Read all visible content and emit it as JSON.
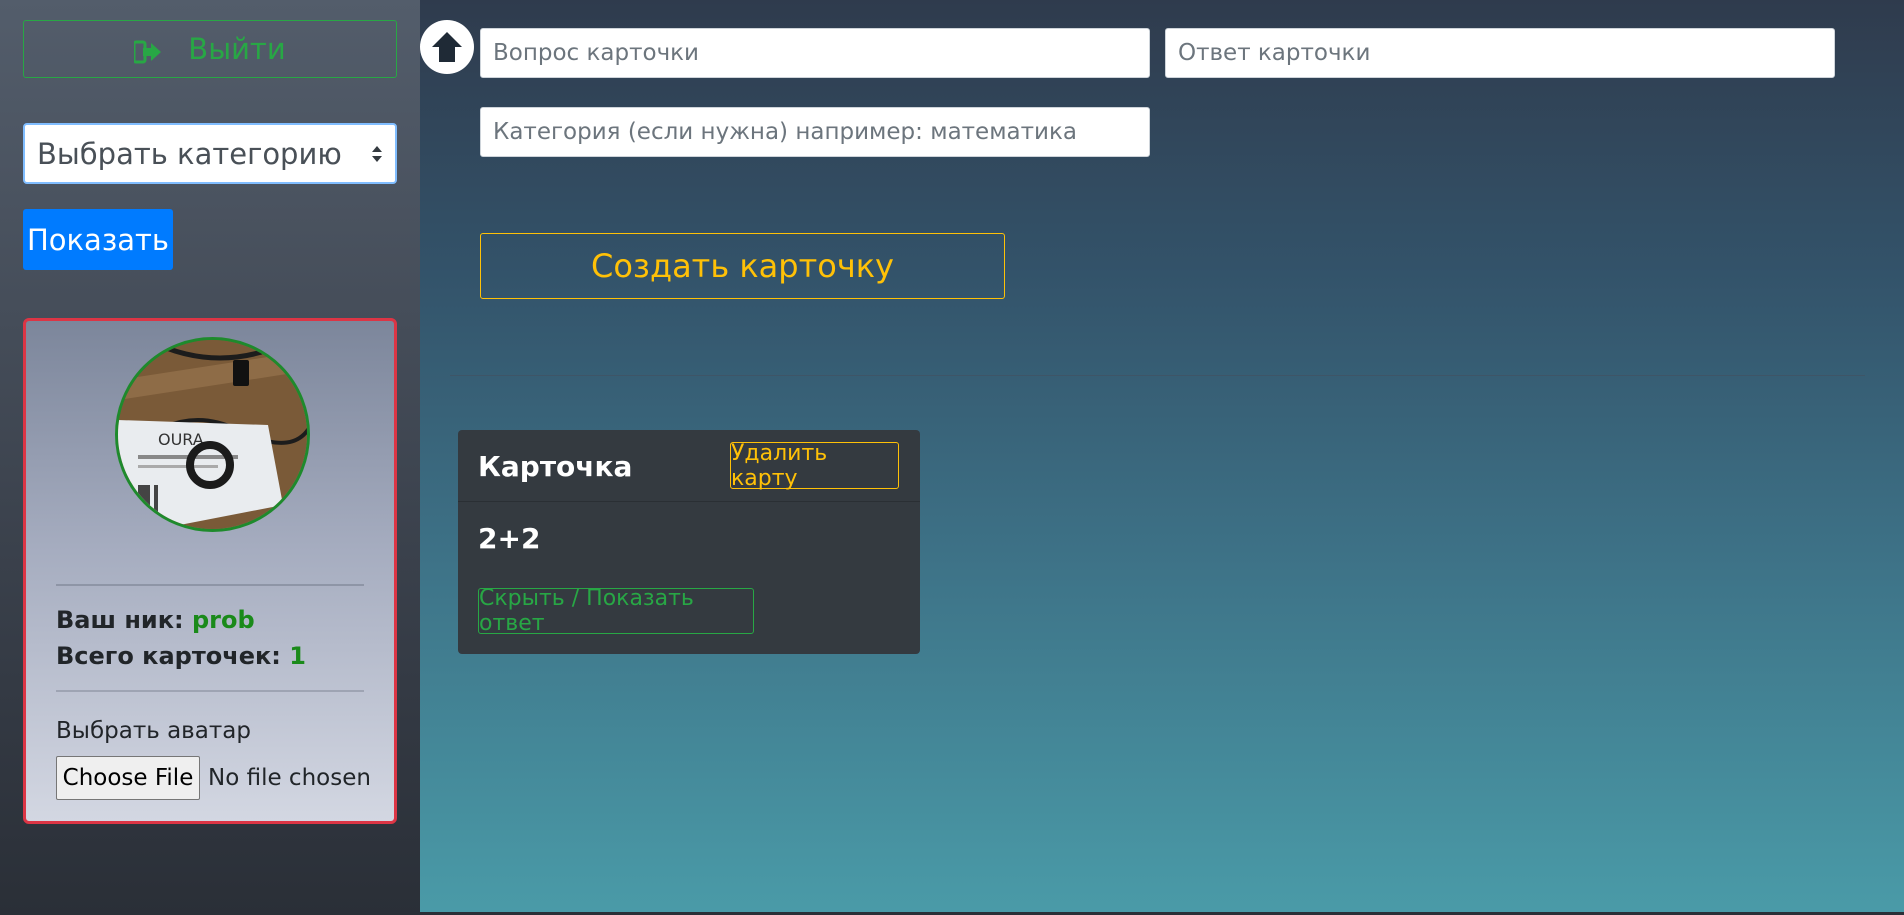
{
  "sidebar": {
    "logout_label": "Выйти",
    "logout_icon": "sign-out-icon",
    "category_select_value": "Выбрать категорию",
    "show_label": "Показать",
    "profile": {
      "nick_label": "Ваш ник:",
      "nick_value": "prob",
      "cards_label": "Всего карточек:",
      "cards_value": "1",
      "avatar_label": "Выбрать аватар",
      "file_button": "Choose File",
      "file_status": "No file chosen"
    }
  },
  "form": {
    "question_placeholder": "Вопрос карточки",
    "answer_placeholder": "Ответ карточки",
    "category_placeholder": "Категория (если нужна) например: математика",
    "create_label": "Создать карточку"
  },
  "cards": [
    {
      "title": "Карточка",
      "delete_label": "Удалить карту",
      "question": "2+2",
      "toggle_label": "Скрыть / Показать ответ"
    }
  ],
  "colors": {
    "success": "#28a745",
    "warning": "#ffc107",
    "primary": "#007bff",
    "danger": "#dc3545"
  }
}
